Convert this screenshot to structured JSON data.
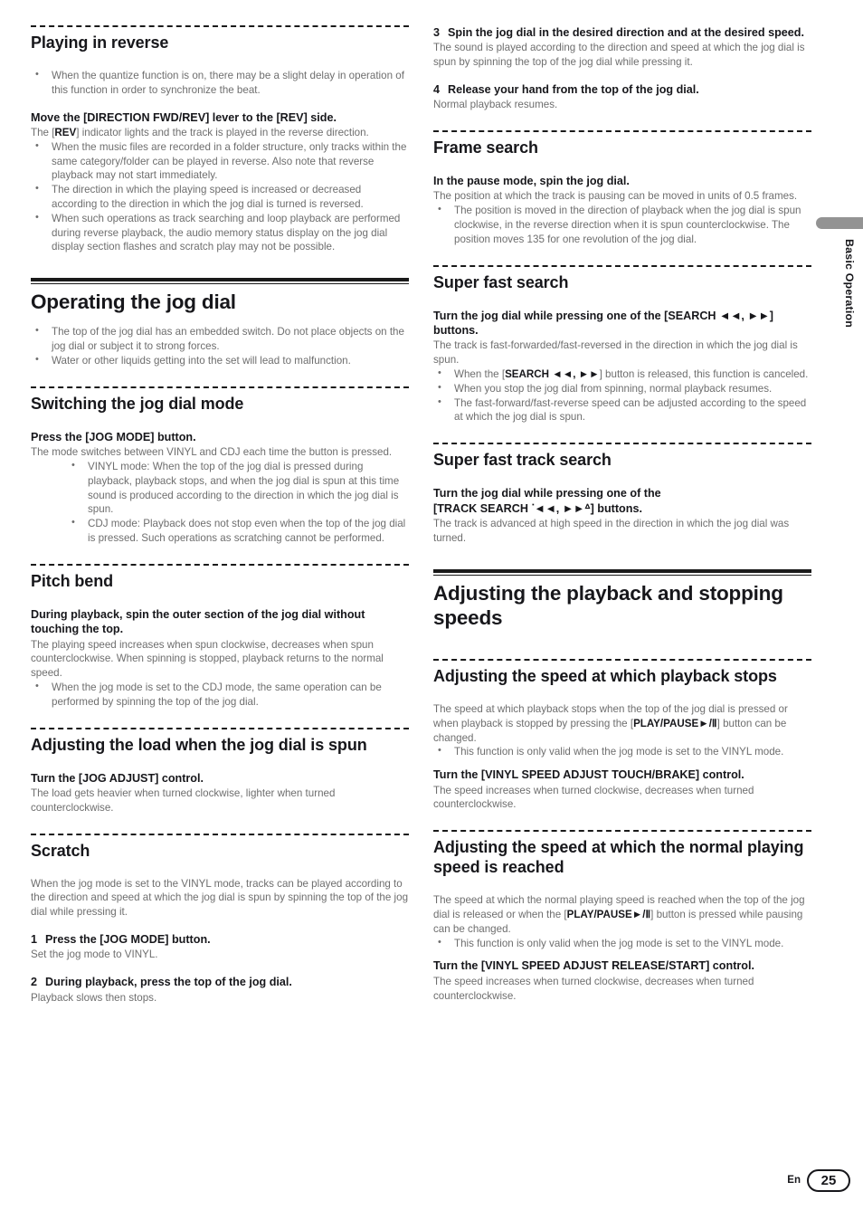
{
  "page": {
    "number": "25",
    "language_code": "En",
    "side_tab_label": "Basic Operation"
  },
  "left_column": {
    "s1": {
      "heading": "Playing in reverse",
      "bullets_top": [
        "When the quantize function is on, there may be a slight delay in operation of this function in order to synchronize the beat."
      ],
      "instruction": "Move the [DIRECTION FWD/REV] lever to the [REV] side.",
      "desc_pre": "The [",
      "desc_bold": "REV",
      "desc_post": "] indicator lights and the track is played in the reverse direction.",
      "bullets": [
        "When the music files are recorded in a folder structure, only tracks within the same category/folder can be played in reverse. Also note that reverse playback may not start immediately.",
        "The direction in which the playing speed is increased or decreased according to the direction in which the jog dial is turned is reversed.",
        "When such operations as track searching and loop playback are performed during reverse playback, the audio memory status display on the jog dial display section flashes and scratch play may not be possible."
      ]
    },
    "s2": {
      "heading": "Operating the jog dial",
      "bullets": [
        "The top of the jog dial has an embedded switch. Do not place objects on the jog dial or subject it to strong forces.",
        "Water or other liquids getting into the set will lead to malfunction."
      ]
    },
    "s3": {
      "heading": "Switching the jog dial mode",
      "instruction": "Press the [JOG MODE] button.",
      "desc": "The mode switches between VINYL and CDJ each time the button is pressed.",
      "bullets": [
        "VINYL mode: When the top of the jog dial is pressed during playback, playback stops, and when the jog dial is spun at this time sound is produced according to the direction in which the jog dial is spun.",
        "CDJ mode: Playback does not stop even when the top of the jog dial is pressed. Such operations as scratching cannot be performed."
      ]
    },
    "s4": {
      "heading": "Pitch bend",
      "instruction": "During playback, spin the outer section of the jog dial without touching the top.",
      "desc": "The playing speed increases when spun clockwise, decreases when spun counterclockwise. When spinning is stopped, playback returns to the normal speed.",
      "bullets": [
        "When the jog mode is set to the CDJ mode, the same operation can be performed by spinning the top of the jog dial."
      ]
    },
    "s5": {
      "heading": "Adjusting the load when the jog dial is spun",
      "instruction": "Turn the [JOG ADJUST] control.",
      "desc": "The load gets heavier when turned clockwise, lighter when turned counterclockwise."
    },
    "s6": {
      "heading": "Scratch",
      "desc": "When the jog mode is set to the VINYL mode, tracks can be played according to the direction and speed at which the jog dial is spun by spinning the top of the jog dial while pressing it.",
      "steps": [
        {
          "num": "1",
          "title": "Press the [JOG MODE] button.",
          "desc": "Set the jog mode to VINYL."
        },
        {
          "num": "2",
          "title": "During playback, press the top of the jog dial.",
          "desc": "Playback slows then stops."
        }
      ]
    }
  },
  "right_column": {
    "steps_cont": [
      {
        "num": "3",
        "title": "Spin the jog dial in the desired direction and at the desired speed.",
        "desc": "The sound is played according to the direction and speed at which the jog dial is spun by spinning the top of the jog dial while pressing it."
      },
      {
        "num": "4",
        "title": "Release your hand from the top of the jog dial.",
        "desc": "Normal playback resumes."
      }
    ],
    "s1": {
      "heading": "Frame search",
      "instruction": "In the pause mode, spin the jog dial.",
      "desc": "The position at which the track is pausing can be moved in units of 0.5 frames.",
      "bullets": [
        "The position is moved in the direction of playback when the jog dial is spun clockwise, in the reverse direction when it is spun counterclockwise. The position moves 135 for one revolution of the jog dial."
      ]
    },
    "s2": {
      "heading": "Super fast search",
      "instruction_pre": "Turn the jog dial while pressing one of the [SEARCH ",
      "instruction_sym1": "◄◄",
      "instruction_mid": ", ",
      "instruction_sym2": "►►",
      "instruction_post": "] buttons.",
      "desc": "The track is fast-forwarded/fast-reversed in the direction in which the jog dial is spun.",
      "bullet1_pre": "When the [",
      "bullet1_bold": "SEARCH ◄◄, ►►",
      "bullet1_post": "] button is released, this function is canceled.",
      "bullets": [
        "When you stop the jog dial from spinning, normal playback resumes.",
        "The fast-forward/fast-reverse speed can be adjusted according to the speed at which the jog dial is spun."
      ]
    },
    "s3": {
      "heading": "Super fast track search",
      "instruction_line1": "Turn the jog dial while pressing one of the",
      "instruction_line2_pre": "[TRACK SEARCH ",
      "instruction_sym1": "ᐝ◄◄",
      "instruction_mid": ", ",
      "instruction_sym2": "►►ᐞ",
      "instruction_post": "] buttons.",
      "desc": "The track is advanced at high speed in the direction in which the jog dial was turned."
    },
    "s4": {
      "heading": "Adjusting the playback and stopping speeds"
    },
    "s5": {
      "heading": "Adjusting the speed at which playback stops",
      "desc_pre": "The speed at which playback stops when the top of the jog dial is pressed or when playback is stopped by pressing the [",
      "desc_bold": "PLAY/PAUSE►/Ⅱ",
      "desc_post": "] button can be changed.",
      "bullets": [
        "This function is only valid when the jog mode is set to the VINYL mode."
      ],
      "instruction": "Turn the [VINYL SPEED ADJUST TOUCH/BRAKE] control.",
      "desc2": "The speed increases when turned clockwise, decreases when turned counterclockwise."
    },
    "s6": {
      "heading": "Adjusting the speed at which the normal playing speed is reached",
      "desc_pre": "The speed at which the normal playing speed is reached when the top of the jog dial is released or when the [",
      "desc_bold": "PLAY/PAUSE►/Ⅱ",
      "desc_post": "] button is pressed while pausing can be changed.",
      "bullets": [
        "This function is only valid when the jog mode is set to the VINYL mode."
      ],
      "instruction": "Turn the [VINYL SPEED ADJUST RELEASE/START] control.",
      "desc2": "The speed increases when turned clockwise, decreases when turned counterclockwise."
    }
  }
}
